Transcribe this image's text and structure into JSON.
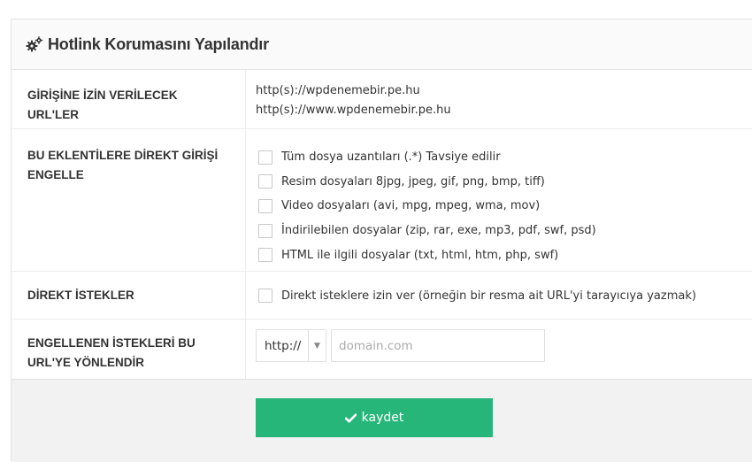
{
  "panel": {
    "title": "Hotlink Korumasını Yapılandır",
    "icon": "cogs-icon"
  },
  "allowed_urls": {
    "label": "GİRİŞİNE İZİN VERİLECEK URL'LER",
    "urls": [
      "http(s)://wpdenemebir.pe.hu",
      "http(s)://www.wpdenemebir.pe.hu"
    ]
  },
  "block_extensions": {
    "label": "BU EKLENTİLERE DİREKT GİRİŞİ ENGELLE",
    "options": [
      {
        "label": "Tüm dosya uzantıları (.*) Tavsiye edilir",
        "checked": false
      },
      {
        "label": "Resim dosyaları 8jpg, jpeg, gif, png, bmp, tiff)",
        "checked": false
      },
      {
        "label": "Video dosyaları (avi, mpg, mpeg, wma, mov)",
        "checked": false
      },
      {
        "label": "İndirilebilen dosyalar (zip, rar, exe, mp3, pdf, swf, psd)",
        "checked": false
      },
      {
        "label": "HTML ile ilgili dosyalar (txt, html, htm, php, swf)",
        "checked": false
      }
    ]
  },
  "direct_requests": {
    "label": "DİREKT İSTEKLER",
    "option": {
      "label": "Direkt isteklere izin ver (örneğin bir resma ait URL'yi tarayıcıya yazmak)",
      "checked": false
    }
  },
  "redirect": {
    "label": "ENGELLENEN İSTEKLERİ BU URL'YE YÖNLENDİR",
    "protocol": "http://",
    "domain_value": "",
    "domain_placeholder": "domain.com"
  },
  "footer": {
    "save_label": "kaydet",
    "save_color": "#27b67a"
  }
}
